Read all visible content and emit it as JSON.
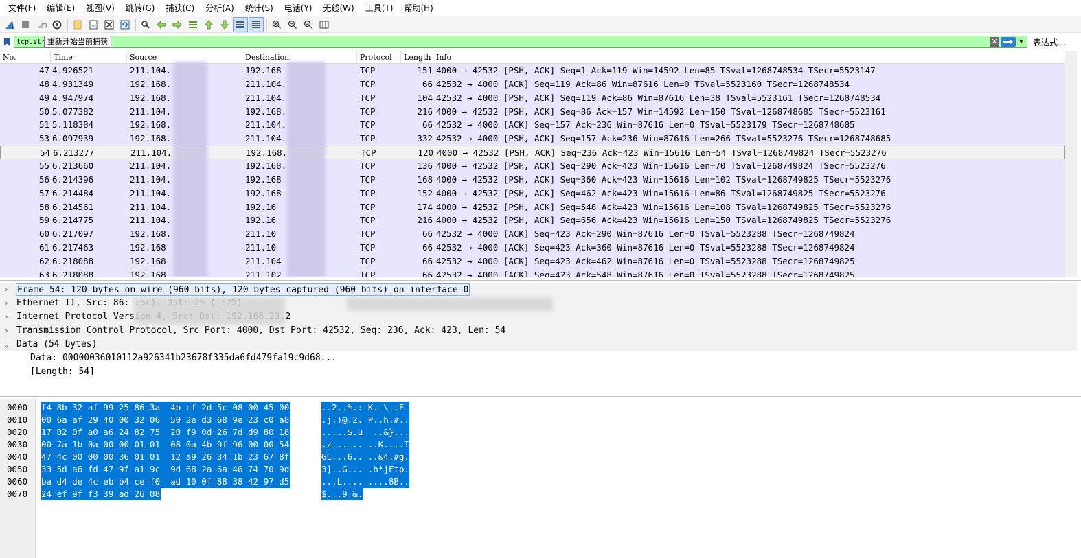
{
  "menu": [
    "文件(F)",
    "编辑(E)",
    "视图(V)",
    "跳转(G)",
    "捕获(C)",
    "分析(A)",
    "统计(S)",
    "电话(Y)",
    "无线(W)",
    "工具(T)",
    "帮助(H)"
  ],
  "toolbar": {
    "icons": [
      "shark-fin-start-icon",
      "stop-icon",
      "restart-icon",
      "options-gear-icon",
      "open-file-icon",
      "save-file-icon",
      "close-file-icon",
      "reload-icon",
      "find-packet-icon",
      "go-back-icon",
      "go-forward-icon",
      "go-to-packet-icon",
      "go-first-icon",
      "go-last-icon",
      "autoscroll-icon",
      "colorize-icon",
      "zoom-in-icon",
      "zoom-out-icon",
      "zoom-normal-icon",
      "resize-columns-icon"
    ]
  },
  "tooltip": "重新开始当前捕获",
  "filter": {
    "value": "tcp.str",
    "expression_label": "表达式…",
    "bg_color": "#afffaf"
  },
  "packet_list": {
    "columns": [
      "No.",
      "Time",
      "Source",
      "Destination",
      "Protocol",
      "Length",
      "Info"
    ],
    "rows": [
      {
        "no": "47",
        "time": "4.926521",
        "src": "211.104.",
        "dst": "192.168",
        "proto": "TCP",
        "len": "151",
        "info": "4000 → 42532 [PSH, ACK] Seq=1 Ack=119 Win=14592 Len=85 TSval=1268748534 TSecr=5523147"
      },
      {
        "no": "48",
        "time": "4.931349",
        "src": "192.168.",
        "dst": "211.104.",
        "proto": "TCP",
        "len": "66",
        "info": "42532 → 4000 [ACK] Seq=119 Ack=86 Win=87616 Len=0 TSval=5523160 TSecr=1268748534"
      },
      {
        "no": "49",
        "time": "4.947974",
        "src": "192.168.",
        "dst": "211.104.",
        "proto": "TCP",
        "len": "104",
        "info": "42532 → 4000 [PSH, ACK] Seq=119 Ack=86 Win=87616 Len=38 TSval=5523161 TSecr=1268748534"
      },
      {
        "no": "50",
        "time": "5.077382",
        "src": "211.104.",
        "dst": "192.168.",
        "proto": "TCP",
        "len": "216",
        "info": "4000 → 42532 [PSH, ACK] Seq=86 Ack=157 Win=14592 Len=150 TSval=1268748685 TSecr=5523161"
      },
      {
        "no": "51",
        "time": "5.118384",
        "src": "192.168.",
        "dst": "211.104.",
        "proto": "TCP",
        "len": "66",
        "info": "42532 → 4000 [ACK] Seq=157 Ack=236 Win=87616 Len=0 TSval=5523179 TSecr=1268748685"
      },
      {
        "no": "53",
        "time": "6.097939",
        "src": "192.168.",
        "dst": "211.104.",
        "proto": "TCP",
        "len": "332",
        "info": "42532 → 4000 [PSH, ACK] Seq=157 Ack=236 Win=87616 Len=266 TSval=5523276 TSecr=1268748685"
      },
      {
        "no": "54",
        "time": "6.213277",
        "src": "211.104.",
        "dst": "192.168.",
        "proto": "TCP",
        "len": "120",
        "info": "4000 → 42532 [PSH, ACK] Seq=236 Ack=423 Win=15616 Len=54 TSval=1268749824 TSecr=5523276",
        "selected": true
      },
      {
        "no": "55",
        "time": "6.213660",
        "src": "211.104.",
        "dst": "192.168.",
        "proto": "TCP",
        "len": "136",
        "info": "4000 → 42532 [PSH, ACK] Seq=290 Ack=423 Win=15616 Len=70 TSval=1268749824 TSecr=5523276"
      },
      {
        "no": "56",
        "time": "6.214396",
        "src": "211.104.",
        "dst": "192.168",
        "proto": "TCP",
        "len": "168",
        "info": "4000 → 42532 [PSH, ACK] Seq=360 Ack=423 Win=15616 Len=102 TSval=1268749825 TSecr=5523276"
      },
      {
        "no": "57",
        "time": "6.214484",
        "src": "211.104.",
        "dst": "192.168",
        "proto": "TCP",
        "len": "152",
        "info": "4000 → 42532 [PSH, ACK] Seq=462 Ack=423 Win=15616 Len=86 TSval=1268749825 TSecr=5523276"
      },
      {
        "no": "58",
        "time": "6.214561",
        "src": "211.104.",
        "dst": "192.16",
        "proto": "TCP",
        "len": "174",
        "info": "4000 → 42532 [PSH, ACK] Seq=548 Ack=423 Win=15616 Len=108 TSval=1268749825 TSecr=5523276"
      },
      {
        "no": "59",
        "time": "6.214775",
        "src": "211.104.",
        "dst": "192.16",
        "proto": "TCP",
        "len": "216",
        "info": "4000 → 42532 [PSH, ACK] Seq=656 Ack=423 Win=15616 Len=150 TSval=1268749825 TSecr=5523276"
      },
      {
        "no": "60",
        "time": "6.217097",
        "src": "192.168.",
        "dst": "211.10",
        "proto": "TCP",
        "len": "66",
        "info": "42532 → 4000 [ACK] Seq=423 Ack=290 Win=87616 Len=0 TSval=5523288 TSecr=1268749824"
      },
      {
        "no": "61",
        "time": "6.217463",
        "src": "192.168",
        "dst": "211.10",
        "proto": "TCP",
        "len": "66",
        "info": "42532 → 4000 [ACK] Seq=423 Ack=360 Win=87616 Len=0 TSval=5523288 TSecr=1268749824"
      },
      {
        "no": "62",
        "time": "6.218088",
        "src": "192.168",
        "dst": "211.104",
        "proto": "TCP",
        "len": "66",
        "info": "42532 → 4000 [ACK] Seq=423 Ack=462 Win=87616 Len=0 TSval=5523288 TSecr=1268749825"
      },
      {
        "no": "63",
        "time": "6.218088",
        "src": "192.168",
        "dst": "211.102",
        "proto": "TCP",
        "len": "66",
        "info": "42532 → 4000 [ACK] Seq=423 Ack=548 Win=87616 Len=0 TSval=5523288 TSecr=1268749825"
      }
    ],
    "row_color": "#e7e6ff"
  },
  "details": [
    {
      "text": "Frame 54: 120 bytes on wire (960 bits), 120 bytes captured (960 bits) on interface 0",
      "expander": "›",
      "selected": true
    },
    {
      "text": "Ethernet II, Src: 86:                         :5c), Dst:                25 (            :25)",
      "expander": "›"
    },
    {
      "text": "Internet Protocol Version 4, Src:                 Dst: 192.168.23.2",
      "expander": "›"
    },
    {
      "text": "Transmission Control Protocol, Src Port: 4000, Dst Port: 42532, Seq: 236, Ack: 423, Len: 54",
      "expander": "›"
    },
    {
      "text": "Data (54 bytes)",
      "expander": "⌄"
    },
    {
      "text": "Data: 00000036010112a926341b23678f335da6fd479fa19c9d68...",
      "expander": "",
      "indent": true,
      "plain": true
    },
    {
      "text": "[Length: 54]",
      "expander": "",
      "indent": true,
      "plain": true
    }
  ],
  "bytes": {
    "rows": [
      {
        "off": "0000",
        "hex": "f4 8b 32 af 99 25 86 3a  4b cf 2d 5c 08 00 45 00",
        "ascii": "..2..%.: K.-\\..E."
      },
      {
        "off": "0010",
        "hex": "00 6a af 29 40 00 32 06  50 2e d3 68 9e 23 c0 a8",
        "ascii": ".j.)@.2. P..h.#.."
      },
      {
        "off": "0020",
        "hex": "17 02 0f a0 a6 24 82 75  20 f9 0d 26 7d d9 80 18",
        "ascii": ".....$.u  ..&}..."
      },
      {
        "off": "0030",
        "hex": "00 7a 1b 0a 00 00 01 01  08 0a 4b 9f 96 00 00 54",
        "ascii": ".z...... ..K....T"
      },
      {
        "off": "0040",
        "hex": "47 4c 00 00 00 36 01 01  12 a9 26 34 1b 23 67 8f",
        "ascii": "GL...6.. ..&4.#g."
      },
      {
        "off": "0050",
        "hex": "33 5d a6 fd 47 9f a1 9c  9d 68 2a 6a 46 74 70 9d",
        "ascii": "3]..G... .h*jFtp."
      },
      {
        "off": "0060",
        "hex": "ba d4 de 4c eb b4 ce f0  ad 10 0f 88 38 42 97 d5",
        "ascii": "...L.... ....8B.."
      },
      {
        "off": "0070",
        "hex": "24 ef 9f f3 39 ad 26 08",
        "ascii": "$...9.&."
      }
    ],
    "highlight_color": "#0078d7"
  }
}
